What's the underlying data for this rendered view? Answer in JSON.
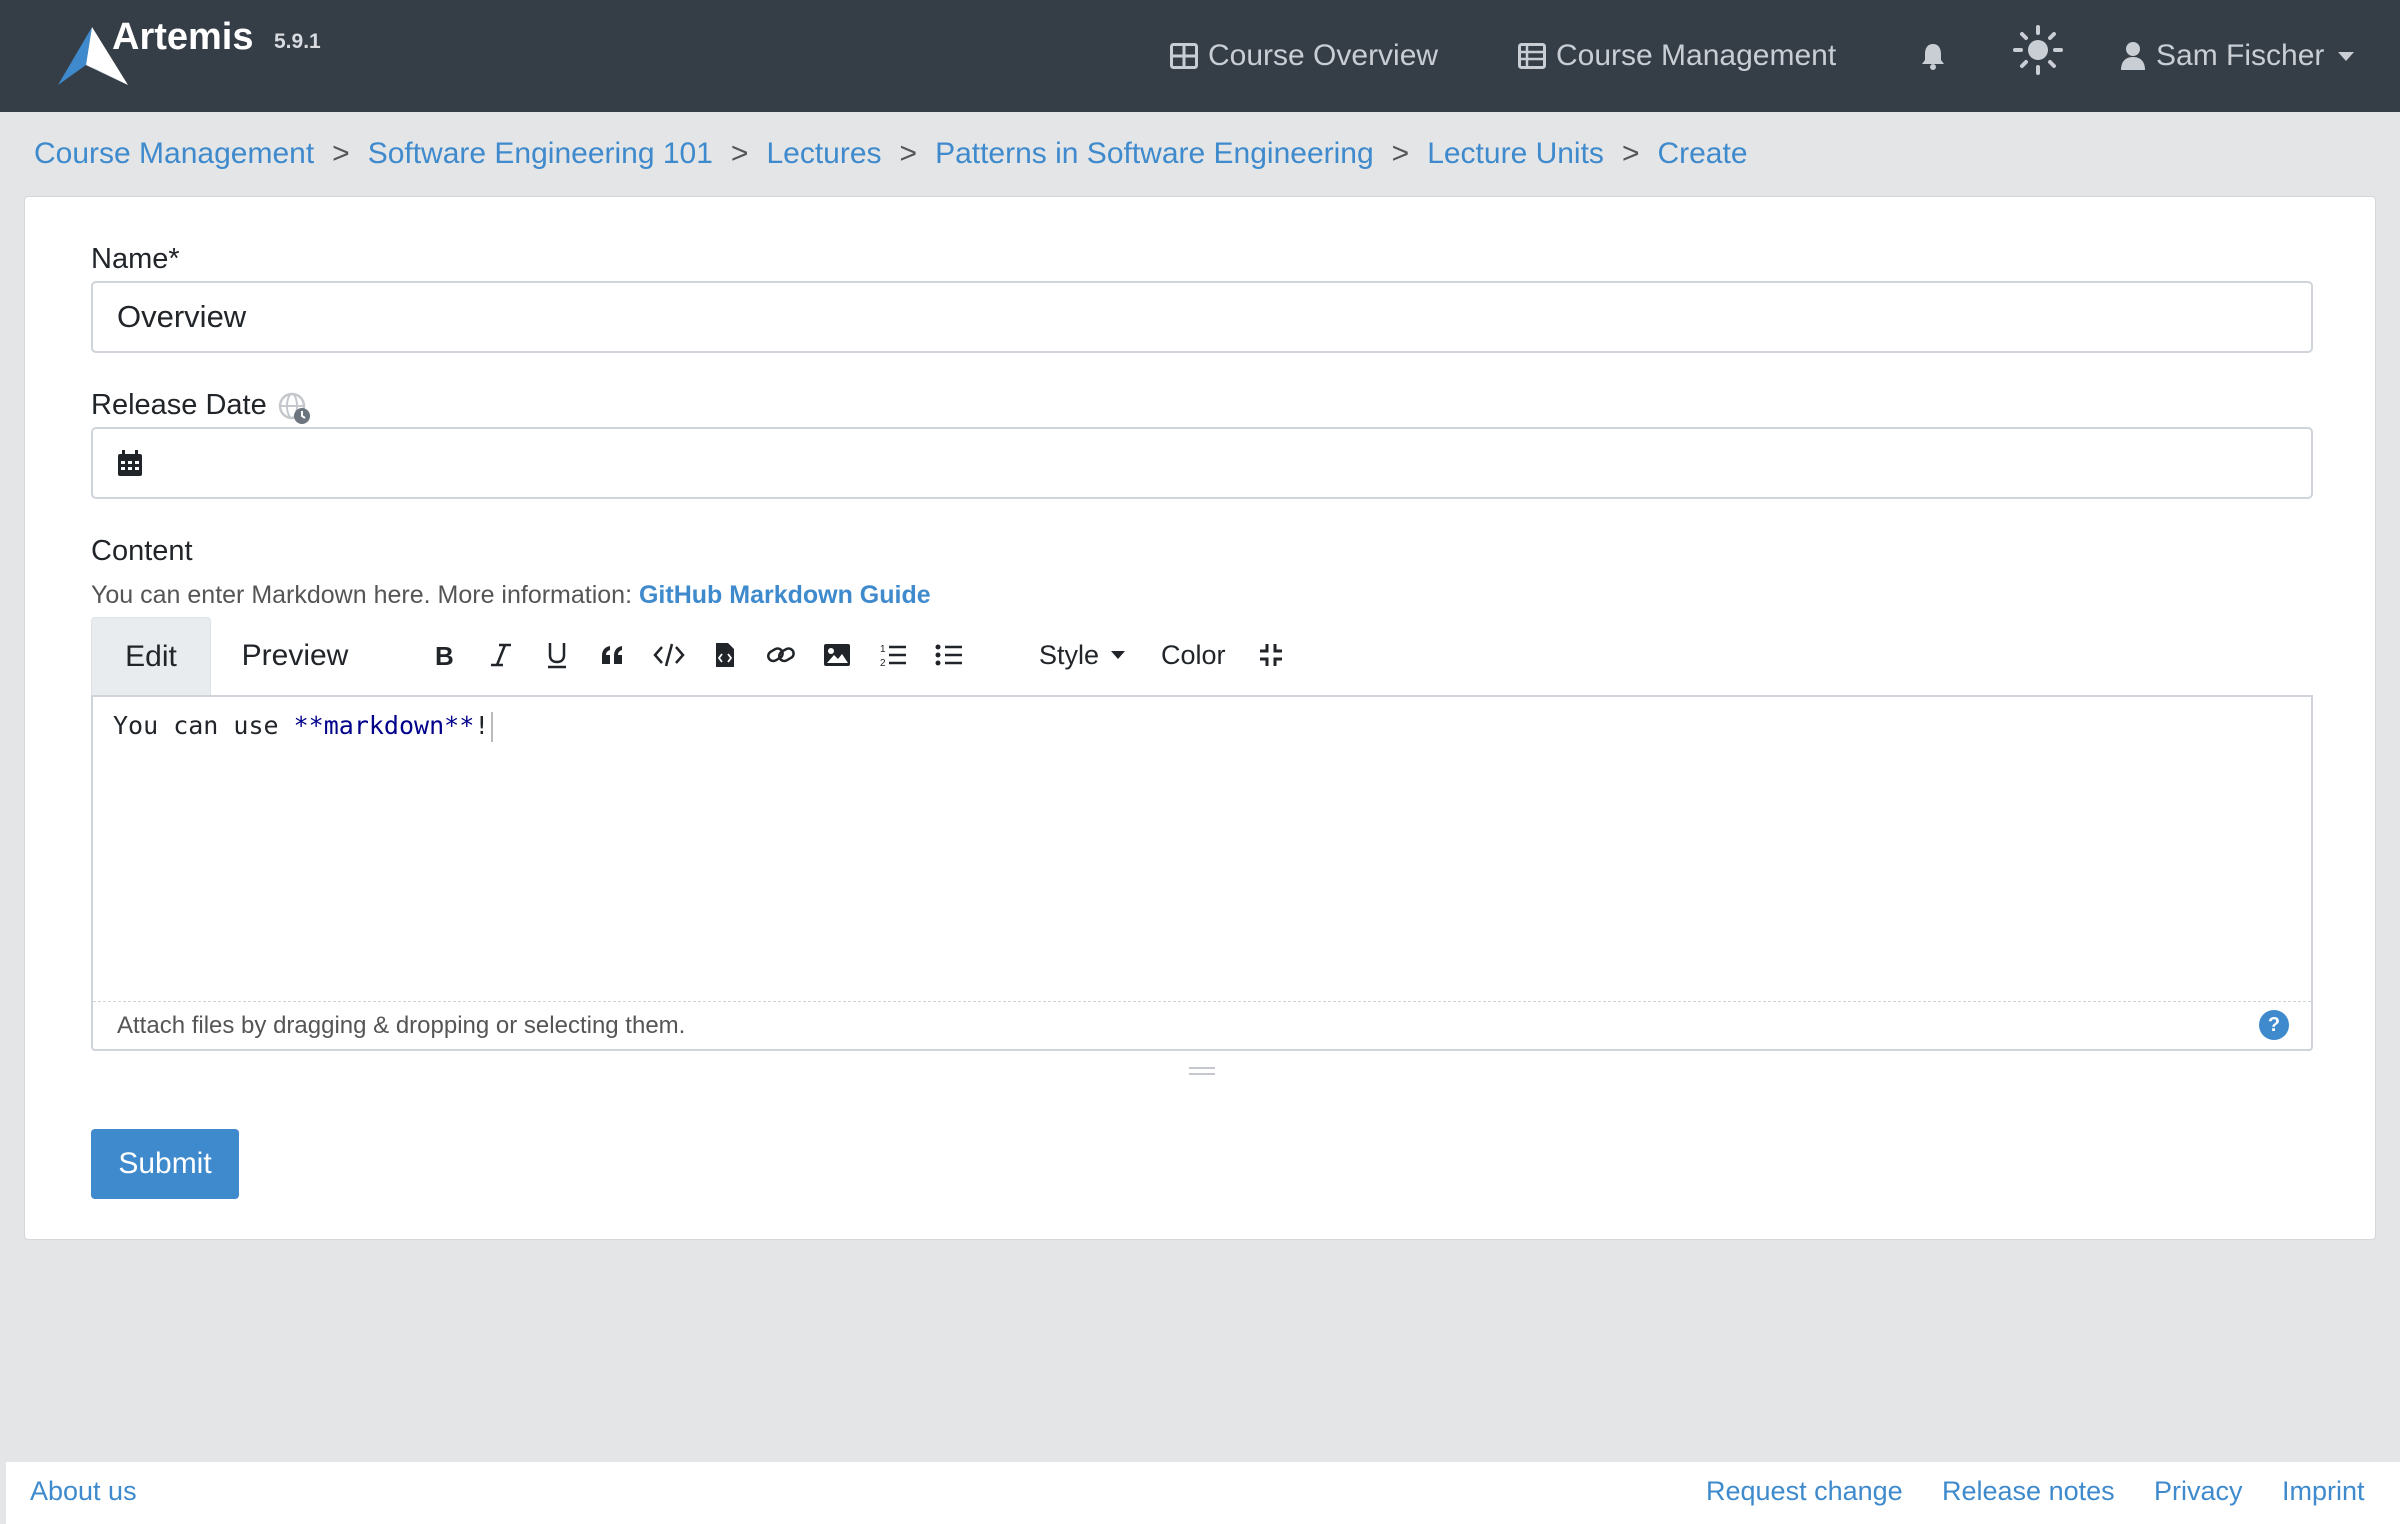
{
  "app": {
    "name": "Artemis",
    "version": "5.9.1"
  },
  "nav": {
    "course_overview": "Course Overview",
    "course_management": "Course Management",
    "user_name": "Sam Fischer"
  },
  "breadcrumb": [
    "Course Management",
    "Software Engineering 101",
    "Lectures",
    "Patterns in Software Engineering",
    "Lecture Units",
    "Create"
  ],
  "form": {
    "name_label": "Name*",
    "name_value": "Overview",
    "release_date_label": "Release Date",
    "release_date_value": "",
    "content_label": "Content",
    "help_text": "You can enter Markdown here. More information: ",
    "help_link": "GitHub Markdown Guide",
    "submit_label": "Submit"
  },
  "editor": {
    "tabs": [
      "Edit",
      "Preview"
    ],
    "active_tab": "Edit",
    "style_label": "Style",
    "color_label": "Color",
    "text_plain": "You can use ",
    "text_bold_markdown": "**markdown**",
    "text_end": "!",
    "attach_hint": "Attach files by dragging & dropping or selecting them.",
    "help_glyph": "?",
    "tools": [
      "bold-icon",
      "italic-icon",
      "underline-icon",
      "quote-icon",
      "code-icon",
      "code-block-icon",
      "link-icon",
      "image-icon",
      "ordered-list-icon",
      "unordered-list-icon",
      "fullscreen-exit-icon"
    ]
  },
  "footer": {
    "about": "About us",
    "request_change": "Request change",
    "release_notes": "Release notes",
    "privacy": "Privacy",
    "imprint": "Imprint"
  },
  "colors": {
    "navbar": "#353d47",
    "accent": "#3e8acc",
    "page_bg": "#e4e5e7"
  }
}
